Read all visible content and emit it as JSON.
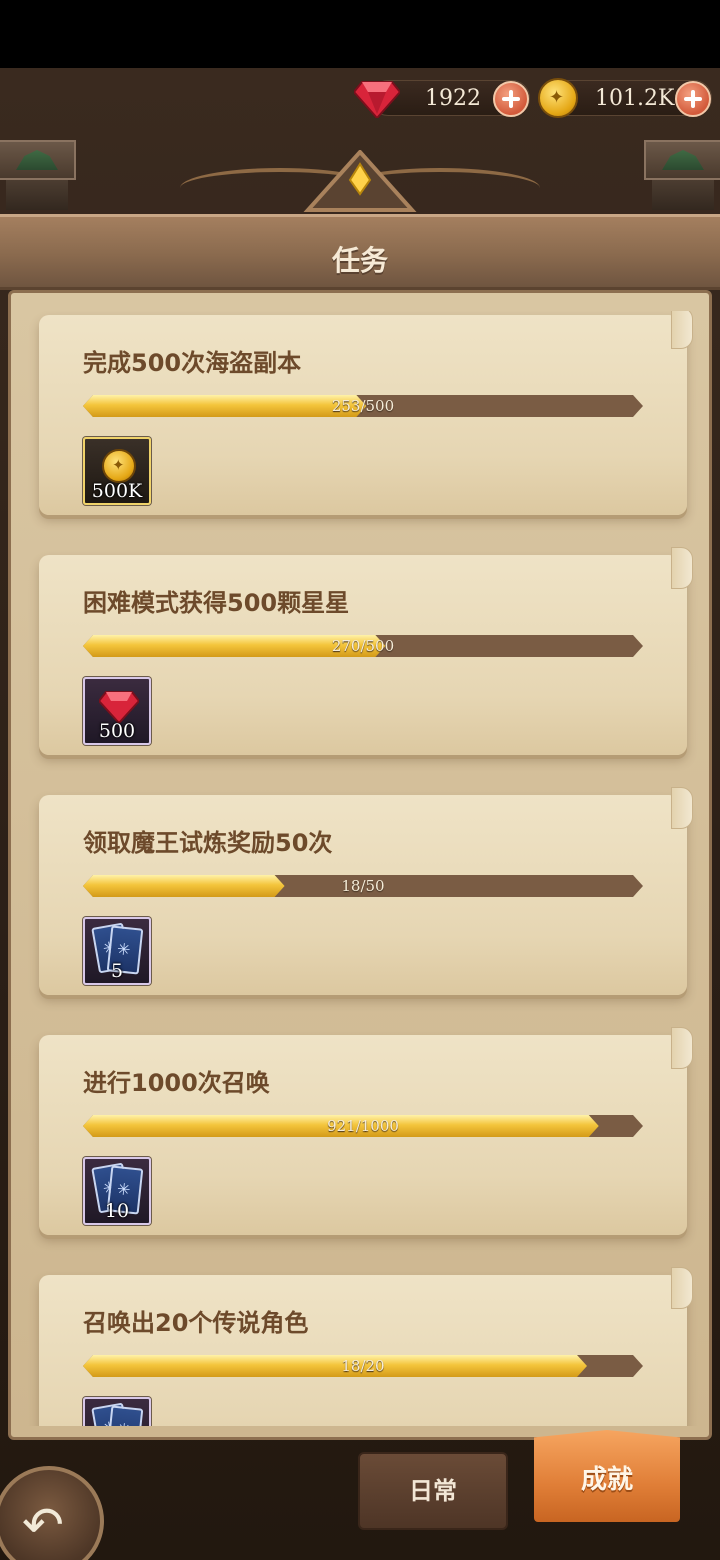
{
  "currency": {
    "gems": "1922",
    "gold": "101.2K"
  },
  "header": {
    "title": "任务"
  },
  "tasks": [
    {
      "title": "完成500次海盗副本",
      "progress_text": "253/500",
      "progress": 0.506,
      "reward_type": "gold-coin",
      "reward_qty": "500K"
    },
    {
      "title": "困难模式获得500颗星星",
      "progress_text": "270/500",
      "progress": 0.54,
      "reward_type": "gem",
      "reward_qty": "500"
    },
    {
      "title": "领取魔王试炼奖励50次",
      "progress_text": "18/50",
      "progress": 0.36,
      "reward_type": "summon-card",
      "reward_qty": "5"
    },
    {
      "title": "进行1000次召唤",
      "progress_text": "921/1000",
      "progress": 0.921,
      "reward_type": "summon-card",
      "reward_qty": "10"
    },
    {
      "title": "召唤出20个传说角色",
      "progress_text": "18/20",
      "progress": 0.9,
      "reward_type": "summon-card",
      "reward_qty": ""
    }
  ],
  "tabs": {
    "daily": "日常",
    "achievements": "成就",
    "active": "achievements"
  },
  "colors": {
    "progress_fill": "#f4c53c",
    "progress_track": "#7a5c44",
    "active_tab": "#e07e37",
    "text_brown": "#6d4a2b"
  },
  "icons": {
    "gem": "red-gem-icon",
    "gold": "gold-coin-icon",
    "add": "plus-icon",
    "back": "back-arrow-icon"
  }
}
